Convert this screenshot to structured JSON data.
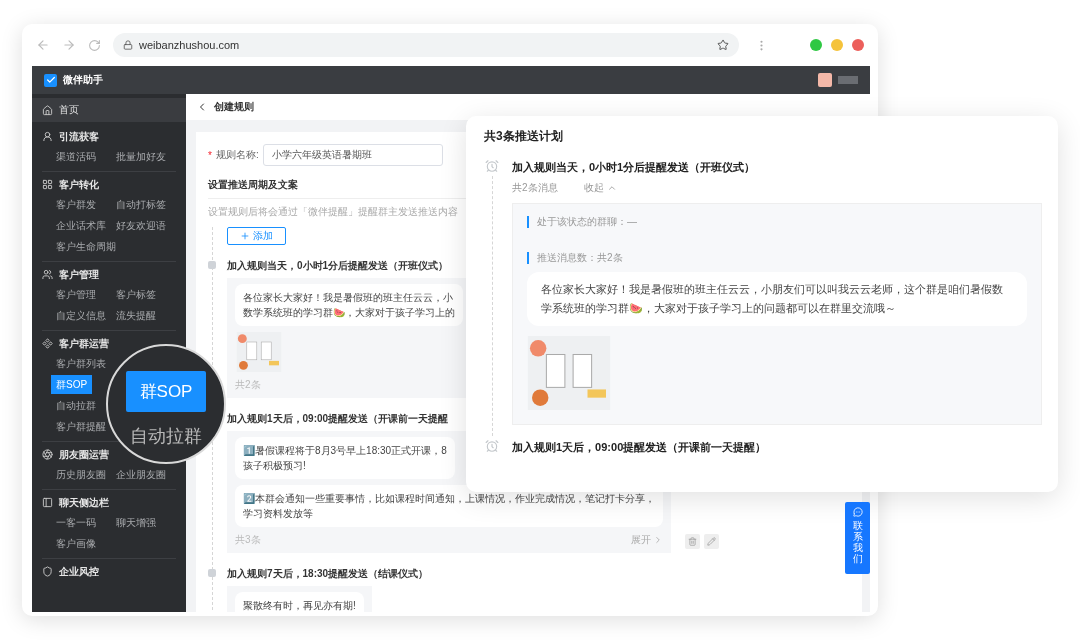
{
  "browser": {
    "url": "weibanzhushou.com"
  },
  "app": {
    "name": "微伴助手"
  },
  "sidebar": {
    "home": "首页",
    "sections": [
      {
        "title": "引流获客",
        "kind": "grid",
        "items": [
          {
            "label": "渠道活码",
            "selected": false
          },
          {
            "label": "批量加好友",
            "selected": false
          }
        ]
      },
      {
        "title": "客户转化",
        "kind": "grid",
        "items": [
          {
            "label": "客户群发",
            "selected": false
          },
          {
            "label": "自动打标签",
            "selected": false
          },
          {
            "label": "企业话术库",
            "selected": false
          },
          {
            "label": "好友欢迎语",
            "selected": false
          },
          {
            "label": "客户生命周期",
            "selected": false
          }
        ]
      },
      {
        "title": "客户管理",
        "kind": "grid",
        "items": [
          {
            "label": "客户管理",
            "selected": false
          },
          {
            "label": "客户标签",
            "selected": false
          },
          {
            "label": "自定义信息",
            "selected": false
          },
          {
            "label": "流失提醒",
            "selected": false
          }
        ]
      },
      {
        "title": "客户群运营",
        "kind": "list",
        "items": [
          {
            "label": "客户群列表",
            "selected": false
          },
          {
            "label": "群SOP",
            "selected": true
          },
          {
            "label": "自动拉群",
            "selected": false
          },
          {
            "label": "客户群提醒",
            "selected": false
          }
        ]
      },
      {
        "title": "朋友圈运营",
        "kind": "grid",
        "items": [
          {
            "label": "历史朋友圈",
            "selected": false
          },
          {
            "label": "企业朋友圈",
            "selected": false
          }
        ]
      },
      {
        "title": "聊天侧边栏",
        "kind": "grid",
        "items": [
          {
            "label": "一客一码",
            "selected": false
          },
          {
            "label": "聊天增强",
            "selected": false
          },
          {
            "label": "客户画像",
            "selected": false
          }
        ]
      },
      {
        "title": "企业风控"
      }
    ]
  },
  "page": {
    "title": "创建规则",
    "form": {
      "required_mark": "*",
      "label": "规则名称:",
      "value": "小学六年级英语暑期班"
    },
    "section_title": "设置推送周期及文案",
    "hint": "设置规则后将会通过「微伴提醒」提醒群主发送推送内容",
    "add_button": "添加",
    "steps": [
      {
        "title": "加入规则当天，0小时1分后提醒发送（开班仪式）",
        "messages": [
          {
            "kind": "text",
            "lines": [
              "各位家长大家好！我是暑假班的班主任云云，小",
              "数学系统班的学习群🍉，大家对于孩子学习上的"
            ]
          },
          {
            "kind": "image"
          }
        ],
        "count": "共2条"
      },
      {
        "title": "加入规则1天后，09:00提醒发送（开课前一天提醒",
        "messages": [
          {
            "kind": "text",
            "lines": [
              "1️⃣暑假课程将于8月3号早上18:30正式开课，8",
              "孩子积极预习!"
            ]
          },
          {
            "kind": "text",
            "lines": [
              "2️⃣本群会通知一些重要事情，比如课程时间通知，上课情况，作业完成情况，笔记打卡分享，",
              "学习资料发放等"
            ]
          }
        ],
        "count": "共3条",
        "expand": "展开"
      },
      {
        "title": "加入规则7天后，18:30提醒发送（结课仪式）",
        "messages": [
          {
            "kind": "text",
            "lines": [
              "聚散终有时，再见亦有期!"
            ]
          }
        ]
      }
    ]
  },
  "magnifier": {
    "button": "群SOP",
    "caption": "自动拉群"
  },
  "panel": {
    "title": "共3条推送计划",
    "plans": [
      {
        "title": "加入规则当天，0小时1分后提醒发送（开班仪式）",
        "message_count": "共2条消息",
        "toggle": "收起",
        "expanded": true,
        "group_label": "处于该状态的群聊：—",
        "push_label": "推送消息数：共2条",
        "messages": [
          {
            "kind": "text",
            "text": "各位家长大家好！我是暑假班的班主任云云，小朋友们可以叫我云云老师，这个群是咱们暑假数学系统班的学习群🍉，大家对于孩子学习上的问题都可以在群里交流哦～"
          },
          {
            "kind": "image"
          }
        ]
      },
      {
        "title": "加入规则1天后，09:00提醒发送（开课前一天提醒）"
      }
    ]
  },
  "contact": {
    "label": "联系我们"
  }
}
